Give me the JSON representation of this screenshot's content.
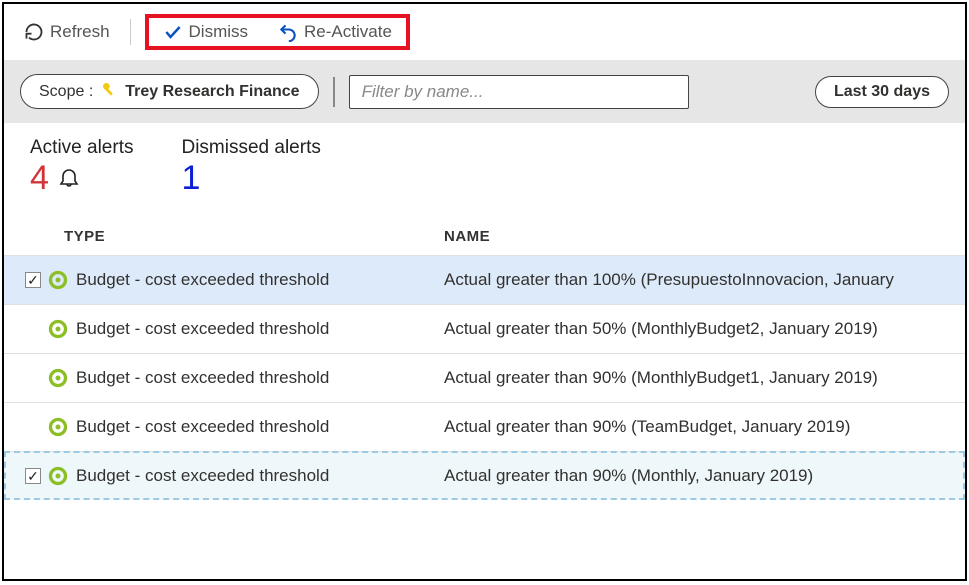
{
  "toolbar": {
    "refresh": "Refresh",
    "dismiss": "Dismiss",
    "reactivate": "Re-Activate"
  },
  "filterbar": {
    "scope_label": "Scope :",
    "scope_value": "Trey Research Finance",
    "filter_placeholder": "Filter by name...",
    "date_range": "Last 30 days"
  },
  "summary": {
    "active_label": "Active alerts",
    "active_count": "4",
    "dismissed_label": "Dismissed alerts",
    "dismissed_count": "1"
  },
  "table": {
    "headers": {
      "type": "TYPE",
      "name": "NAME"
    },
    "rows": [
      {
        "checked": true,
        "selected": true,
        "dashed": false,
        "type": "Budget - cost exceeded threshold",
        "name": "Actual greater than 100% (PresupuestoInnovacion, January "
      },
      {
        "checked": false,
        "selected": false,
        "dashed": false,
        "type": "Budget - cost exceeded threshold",
        "name": "Actual greater than 50% (MonthlyBudget2, January 2019)"
      },
      {
        "checked": false,
        "selected": false,
        "dashed": false,
        "type": "Budget - cost exceeded threshold",
        "name": "Actual greater than 90% (MonthlyBudget1, January 2019)"
      },
      {
        "checked": false,
        "selected": false,
        "dashed": false,
        "type": "Budget - cost exceeded threshold",
        "name": "Actual greater than 90% (TeamBudget, January 2019)"
      },
      {
        "checked": true,
        "selected": false,
        "dashed": true,
        "type": "Budget - cost exceeded threshold",
        "name": "Actual greater than 90% (Monthly, January 2019)"
      }
    ]
  }
}
